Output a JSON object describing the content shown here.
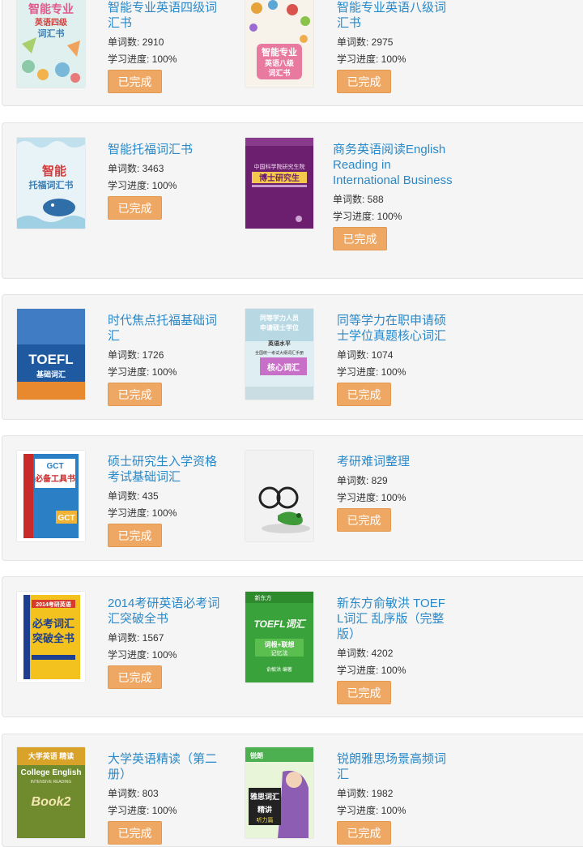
{
  "labels": {
    "word_count_prefix": "单词数: ",
    "progress_prefix": "学习进度: ",
    "done_button": "已完成"
  },
  "books": [
    {
      "title": "智能专业英语四级词汇书",
      "words": "2910",
      "progress": "100%",
      "cover": {
        "lines": [
          "智能专业",
          "英语四级",
          "词汇书"
        ]
      }
    },
    {
      "title": "智能专业英语八级词汇书",
      "words": "2975",
      "progress": "100%",
      "cover": {
        "lines": [
          "智能专业",
          "英语八级",
          "词汇书"
        ]
      }
    },
    {
      "title": "智能托福词汇书",
      "words": "3463",
      "progress": "100%",
      "cover": {
        "lines": [
          "智能",
          "托福词汇书"
        ]
      }
    },
    {
      "title": "商务英语阅读English Reading in International Business",
      "words": "588",
      "progress": "100%",
      "cover": {
        "lines": [
          "中国科学院研究生院",
          "博士研究生"
        ]
      }
    },
    {
      "title": "时代焦点托福基础词汇",
      "words": "1726",
      "progress": "100%",
      "cover": {
        "lines": [
          "TOEFL",
          "基础词汇"
        ]
      }
    },
    {
      "title": "同等学力在职申请硕士学位真题核心词汇",
      "words": "1074",
      "progress": "100%",
      "cover": {
        "lines": [
          "同等学力人员",
          "申请硕士学位",
          "英语水平",
          "全国统一考试大纲词汇手册",
          "核心词汇"
        ]
      }
    },
    {
      "title": "硕士研究生入学资格考试基础词汇",
      "words": "435",
      "progress": "100%",
      "cover": {
        "lines": [
          "GCT",
          "必备工具书",
          "GCT"
        ]
      }
    },
    {
      "title": "考研难词整理",
      "words": "829",
      "progress": "100%",
      "cover": {
        "lines": []
      }
    },
    {
      "title": "2014考研英语必考词汇突破全书",
      "words": "1567",
      "progress": "100%",
      "cover": {
        "lines": [
          "2014考研英语",
          "必考词汇",
          "突破全书"
        ]
      }
    },
    {
      "title": "新东方俞敏洪 TOEFL词汇 乱序版（完整版）",
      "words": "4202",
      "progress": "100%",
      "cover": {
        "lines": [
          "新东方",
          "TOEFL词汇",
          "词根+联想",
          "记忆法",
          "俞敏洪 编著"
        ]
      }
    },
    {
      "title": "大学英语精读（第二册）",
      "words": "803",
      "progress": "100%",
      "cover": {
        "lines": [
          "大学英语 精读",
          "College English",
          "INTENSIVE READING",
          "Book2"
        ]
      }
    },
    {
      "title": "锐朗雅思场景高频词汇",
      "words": "1982",
      "progress": "100%",
      "cover": {
        "lines": [
          "锐朗",
          "雅思词汇",
          "精讲",
          "听力篇"
        ]
      }
    }
  ],
  "colors": {
    "title_link": "#2a89c8",
    "done_button_bg": "#efa864",
    "panel_bg": "#f5f5f5",
    "panel_border": "#e3e3e3"
  }
}
